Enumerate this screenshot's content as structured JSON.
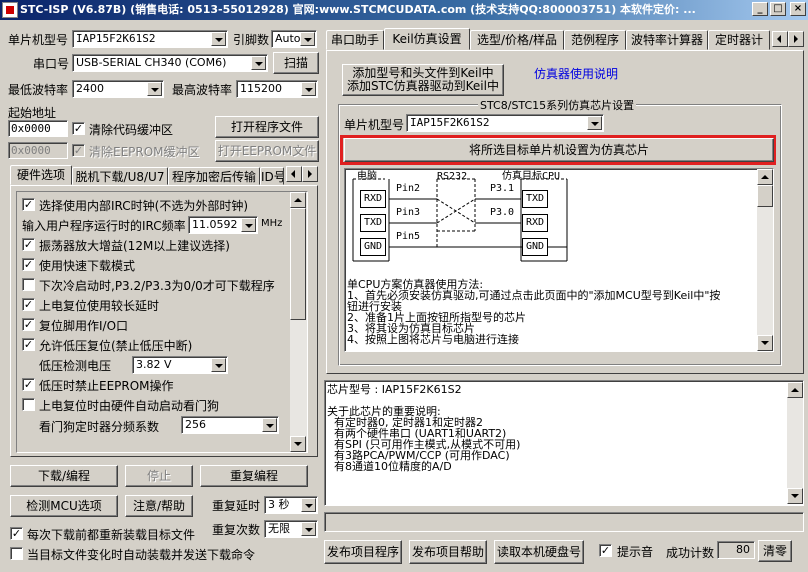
{
  "window": {
    "title": "STC-ISP (V6.87B) (销售电话: 0513-55012928) 官网:www.STCMCUDATA.com  (技术支持QQ:800003751) 本软件定价: ..."
  },
  "left": {
    "mcu_type_label": "单片机型号",
    "mcu_type_value": "IAP15F2K61S2",
    "pin_label": "引脚数",
    "pin_value": "Auto",
    "port_label": "串口号",
    "port_value": "USB-SERIAL CH340 (COM6)",
    "scan_label": "扫描",
    "min_baud_label": "最低波特率",
    "min_baud_value": "2400",
    "max_baud_label": "最高波特率",
    "max_baud_value": "115200",
    "start_addr_label": "起始地址",
    "addr1_value": "0x0000",
    "clear_code_label": "清除代码缓冲区",
    "open_prog_label": "打开程序文件",
    "addr2_value": "0x0000",
    "clear_eeprom_label": "清除EEPROM缓冲区",
    "open_eeprom_label": "打开EEPROM文件",
    "tabs": [
      "硬件选项",
      "脱机下载/U8/U7",
      "程序加密后传输",
      "ID号"
    ],
    "options": [
      {
        "label": "选择使用内部IRC时钟(不选为外部时钟)",
        "checked": true
      },
      {
        "label": "输入用户程序运行时的IRC频率",
        "value": "11.0592",
        "unit": "MHz"
      },
      {
        "label": "振荡器放大增益(12M以上建议选择)",
        "checked": true
      },
      {
        "label": "使用快速下载模式",
        "checked": true
      },
      {
        "label": "下次冷启动时,P3.2/P3.3为0/0才可下载程序",
        "checked": false
      },
      {
        "label": "上电复位使用较长延时",
        "checked": true
      },
      {
        "label": "复位脚用作I/O口",
        "checked": true
      },
      {
        "label": "允许低压复位(禁止低压中断)",
        "checked": true
      },
      {
        "label": "低压检测电压",
        "value": "3.82 V"
      },
      {
        "label": "低压时禁止EEPROM操作",
        "checked": true
      },
      {
        "label": "上电复位时由硬件自动启动看门狗",
        "checked": false
      },
      {
        "label": "看门狗定时器分频系数",
        "value": "256"
      }
    ],
    "download_label": "下载/编程",
    "stop_label": "停止",
    "reprogram_label": "重复编程",
    "detect_label": "检测MCU选项",
    "help_label": "注意/帮助",
    "repeat_delay_label": "重复延时",
    "repeat_delay_value": "3 秒",
    "repeat_count_label": "重复次数",
    "repeat_count_value": "无限",
    "reload_label": "每次下载前都重新装载目标文件",
    "reload_checked": true,
    "autoload_label": "当目标文件变化时自动装载并发送下载命令",
    "autoload_checked": false
  },
  "right": {
    "tabs": [
      "串口助手",
      "Keil仿真设置",
      "选型/价格/样品",
      "范例程序",
      "波特率计算器",
      "定时器计"
    ],
    "add_keil_line1": "添加型号和头文件到Keil中",
    "add_keil_line2": "添加STC仿真器驱动到Keil中",
    "emu_help_link": "仿真器使用说明",
    "group_title": "STC8/STC15系列仿真芯片设置",
    "mcu_type_label": "单片机型号",
    "mcu_type_value": "IAP15F2K61S2",
    "set_emu_label": "将所选目标单片机设置为仿真芯片",
    "diagram": {
      "pc": "电脑",
      "rs232": "RS232",
      "target": "仿真目标CPU",
      "pc_pins": [
        "RXD",
        "TXD",
        "GND"
      ],
      "mid_pins": [
        "Pin2",
        "Pin3",
        "Pin5"
      ],
      "cpu_port_labels": [
        "P3.1",
        "P3.0"
      ],
      "cpu_pins": [
        "TXD",
        "RXD",
        "GND"
      ]
    },
    "instructions": [
      "单CPU方案仿真器使用方法:",
      "1、首先必须安装仿真驱动,可通过点击此页面中的\"添加MCU型号到Keil中\"按",
      "钮进行安装",
      "2、准备1片上面按钮所指型号的芯片",
      "3、将其设为仿真目标芯片",
      "4、按照上图将芯片与电脑进行连接"
    ],
    "info_lines": [
      "芯片型号 : IAP15F2K61S2",
      "",
      "关于此芯片的重要说明:",
      "  有定时器0, 定时器1和定时器2",
      "  有两个硬件串口 (UART1和UART2)",
      "  有SPI (只可用作主模式,从模式不可用)",
      "  有3路PCA/PWM/CCP (可用作DAC)",
      "  有8通道10位精度的A/D"
    ],
    "publish_prog_label": "发布项目程序",
    "publish_help_label": "发布项目帮助",
    "read_disk_label": "读取本机硬盘号",
    "beep_label": "提示音",
    "beep_checked": true,
    "success_label": "成功计数",
    "success_value": "80",
    "clear_label": "清零"
  }
}
